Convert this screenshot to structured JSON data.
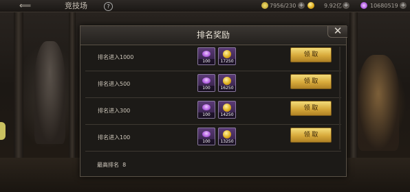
{
  "topbar": {
    "back_glyph": "⟸",
    "title": "竞技场",
    "help_label": "?",
    "stamina": "7956/230",
    "gold": "9.92亿",
    "gems": "10680519",
    "plus": "+"
  },
  "dialog": {
    "title": "排名奖励",
    "close_glyph": "✕",
    "rows": [
      {
        "label": "排名进入1000",
        "gem_qty": "100",
        "coin_qty": "17250",
        "button": "领 取"
      },
      {
        "label": "排名进入500",
        "gem_qty": "100",
        "coin_qty": "16250",
        "button": "领 取"
      },
      {
        "label": "排名进入300",
        "gem_qty": "100",
        "coin_qty": "14250",
        "button": "领 取"
      },
      {
        "label": "排名进入100",
        "gem_qty": "100",
        "coin_qty": "13250",
        "button": "领 取"
      }
    ],
    "best_rank_label": "最高排名",
    "best_rank_value": "8"
  },
  "colors": {
    "claim_button": "#d7a93a",
    "item_frame": "#5a3a75",
    "gem": "#b060e0",
    "coin": "#e0b020"
  }
}
